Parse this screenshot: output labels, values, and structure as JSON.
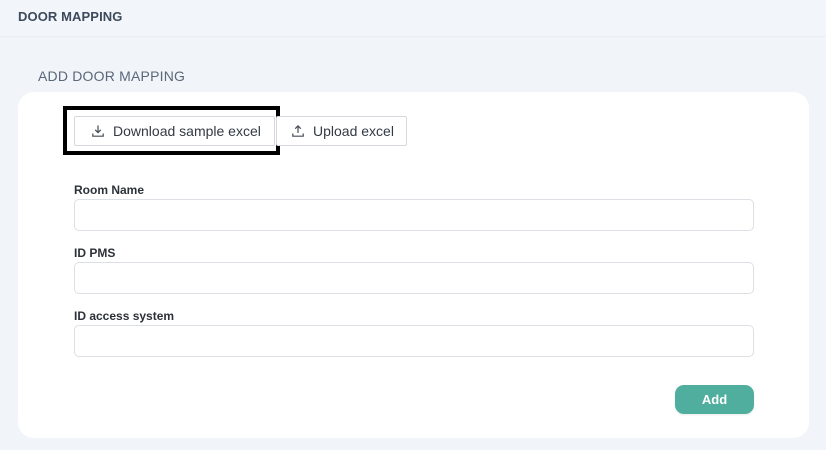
{
  "header": {
    "title": "DOOR MAPPING"
  },
  "section": {
    "title": "ADD DOOR MAPPING"
  },
  "actions": {
    "download_label": "Download sample excel",
    "download_icon": "download-icon",
    "upload_label": "Upload excel",
    "upload_icon": "upload-icon"
  },
  "form": {
    "fields": [
      {
        "label": "Room Name",
        "value": "",
        "placeholder": ""
      },
      {
        "label": "ID PMS",
        "value": "",
        "placeholder": ""
      },
      {
        "label": "ID access system",
        "value": "",
        "placeholder": ""
      }
    ],
    "submit_label": "Add"
  },
  "colors": {
    "page_background": "#f1f5f9",
    "card_background": "#ffffff",
    "accent_button": "#4fae9e",
    "title_text": "#3c4a5c",
    "highlight_frame": "#000000"
  }
}
